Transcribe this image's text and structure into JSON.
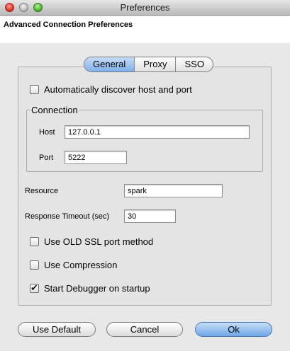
{
  "window": {
    "title": "Preferences"
  },
  "header": {
    "title": "Advanced Connection Preferences"
  },
  "tabs": [
    {
      "label": "General",
      "active": true
    },
    {
      "label": "Proxy",
      "active": false
    },
    {
      "label": "SSO",
      "active": false
    }
  ],
  "general": {
    "auto_discover": {
      "label": "Automatically discover host and port",
      "checked": false
    },
    "connection": {
      "title": "Connection",
      "host": {
        "label": "Host",
        "value": "127.0.0.1"
      },
      "port": {
        "label": "Port",
        "value": "5222"
      }
    },
    "resource": {
      "label": "Resource",
      "value": "spark"
    },
    "timeout": {
      "label": "Response Timeout (sec)",
      "value": "30"
    },
    "old_ssl": {
      "label": "Use OLD SSL port method",
      "checked": false
    },
    "compression": {
      "label": "Use Compression",
      "checked": false
    },
    "debugger": {
      "label": "Start Debugger on startup",
      "checked": true
    }
  },
  "buttons": {
    "use_default": "Use Default",
    "cancel": "Cancel",
    "ok": "Ok"
  },
  "colors": {
    "accent": "#7eb0ea",
    "close": "#d8382a",
    "zoom": "#4fb52c"
  }
}
